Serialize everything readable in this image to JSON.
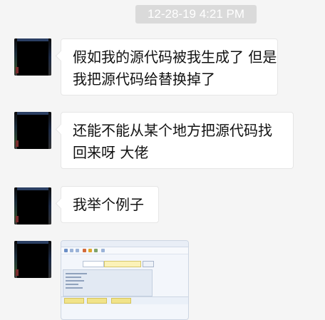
{
  "chat": {
    "timestamp": "12-28-19 4:21 PM",
    "messages": [
      {
        "lines": [
          "假如我的源代码被我生成了 但是",
          "我把源代码给替换掉了"
        ]
      },
      {
        "lines": [
          "还能不能从某个地方把源代码找",
          "回来呀 大佬"
        ]
      },
      {
        "lines": [
          "我举个例子"
        ]
      }
    ]
  }
}
